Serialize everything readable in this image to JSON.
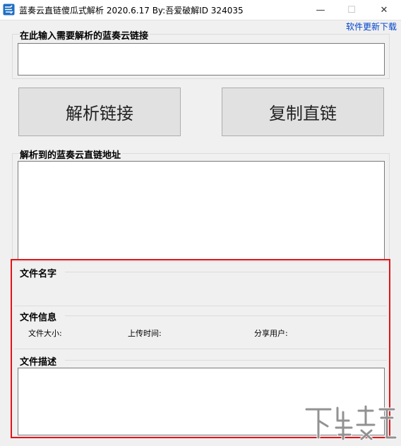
{
  "window": {
    "title": "蓝奏云直链傻瓜式解析  2020.6.17  By:吾爱破解ID  324035",
    "minimize_glyph": "—",
    "maximize_glyph": "☐",
    "close_glyph": "✕"
  },
  "header": {
    "update_link": "软件更新下载"
  },
  "input_section": {
    "label": "在此输入需要解析的蓝奏云链接",
    "value": ""
  },
  "buttons": {
    "parse": "解析链接",
    "copy": "复制直链"
  },
  "result_section": {
    "label": "解析到的蓝奏云直链地址",
    "value": ""
  },
  "file_name": {
    "label": "文件名字",
    "value": ""
  },
  "file_info": {
    "label": "文件信息",
    "size_label": "文件大小:",
    "size_value": "",
    "upload_time_label": "上传时间:",
    "upload_time_value": "",
    "share_user_label": "分享用户:",
    "share_user_value": ""
  },
  "file_desc": {
    "label": "文件描述",
    "value": ""
  },
  "colors": {
    "highlight": "#e0141a",
    "link": "#0044cc"
  },
  "icons": {
    "app": "app-logo-icon",
    "watermark": "watermark-logo"
  }
}
